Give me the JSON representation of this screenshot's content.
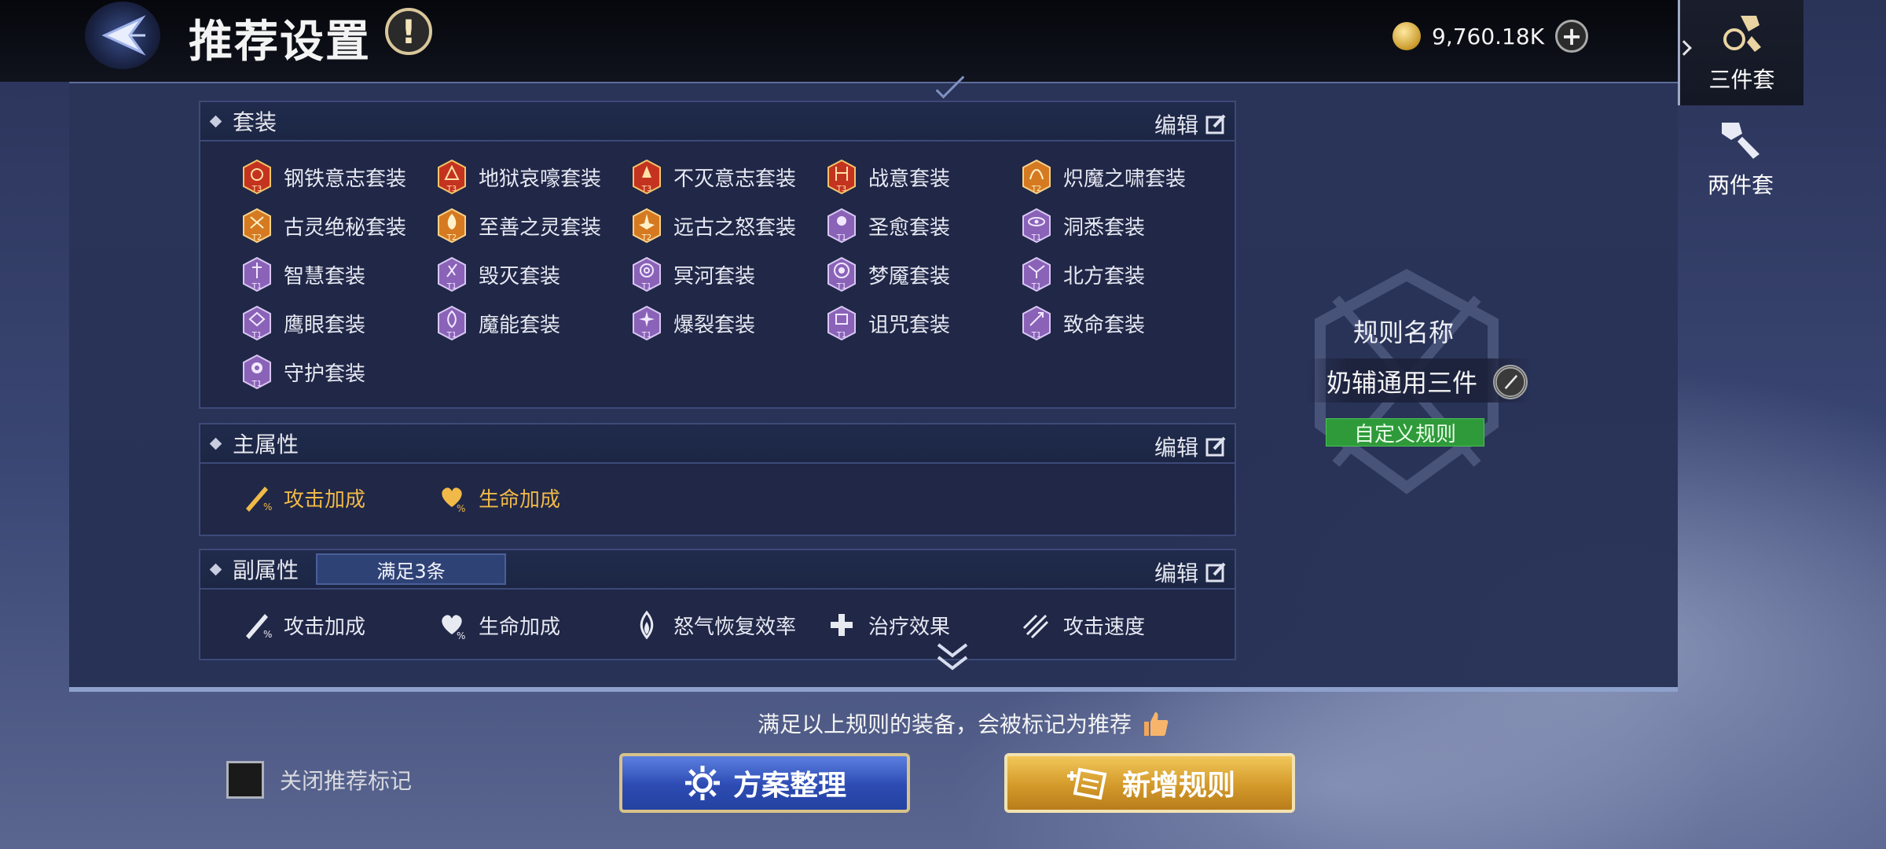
{
  "header": {
    "title": "推荐设置",
    "info_glyph": "!"
  },
  "currency": {
    "amount": "9,760.18K",
    "add_glyph": "+"
  },
  "sets_section": {
    "title": "套装",
    "edit_label": "编辑",
    "items": [
      {
        "name": "钢铁意志套装",
        "tier": "T3"
      },
      {
        "name": "地狱哀嚎套装",
        "tier": "T3"
      },
      {
        "name": "不灭意志套装",
        "tier": "T3"
      },
      {
        "name": "战意套装",
        "tier": "T3"
      },
      {
        "name": "炽魔之啸套装",
        "tier": "T2"
      },
      {
        "name": "古灵绝秘套装",
        "tier": "T2"
      },
      {
        "name": "至善之灵套装",
        "tier": "T2"
      },
      {
        "name": "远古之怒套装",
        "tier": "T2"
      },
      {
        "name": "圣愈套装",
        "tier": "T1"
      },
      {
        "name": "洞悉套装",
        "tier": "T1"
      },
      {
        "name": "智慧套装",
        "tier": "T1"
      },
      {
        "name": "毁灭套装",
        "tier": "T1"
      },
      {
        "name": "冥河套装",
        "tier": "T1"
      },
      {
        "name": "梦魇套装",
        "tier": "T1"
      },
      {
        "name": "北方套装",
        "tier": "T1"
      },
      {
        "name": "鹰眼套装",
        "tier": "T1"
      },
      {
        "name": "魔能套装",
        "tier": "T1"
      },
      {
        "name": "爆裂套装",
        "tier": "T1"
      },
      {
        "name": "诅咒套装",
        "tier": "T1"
      },
      {
        "name": "致命套装",
        "tier": "T1"
      },
      {
        "name": "守护套装",
        "tier": "T1"
      }
    ]
  },
  "main_stat_section": {
    "title": "主属性",
    "edit_label": "编辑",
    "items": [
      {
        "name": "攻击加成",
        "icon": "attack-bonus-icon"
      },
      {
        "name": "生命加成",
        "icon": "hp-bonus-icon"
      }
    ]
  },
  "sub_stat_section": {
    "title": "副属性",
    "requirement": "满足3条",
    "edit_label": "编辑",
    "items": [
      {
        "name": "攻击加成",
        "icon": "attack-bonus-icon"
      },
      {
        "name": "生命加成",
        "icon": "hp-bonus-icon"
      },
      {
        "name": "怒气恢复效率",
        "icon": "rage-regen-icon"
      },
      {
        "name": "治疗效果",
        "icon": "healing-icon"
      },
      {
        "name": "攻击速度",
        "icon": "attack-speed-icon"
      }
    ]
  },
  "rule": {
    "label": "规则名称",
    "name": "奶辅通用三件",
    "tag": "自定义规则"
  },
  "tabs": [
    {
      "label": "三件套",
      "active": true
    },
    {
      "label": "两件套",
      "active": false
    }
  ],
  "footer": {
    "hint": "满足以上规则的装备，会被标记为推荐",
    "checkbox_label": "关闭推荐标记",
    "organize_button": "方案整理",
    "add_rule_button": "新增规则"
  },
  "colors": {
    "tier3": "#c4331f",
    "tier2": "#d57a21",
    "tier1": "#8a63b8",
    "main_stat_text": "#f0b948",
    "rule_tag": "#2f9a3a"
  }
}
